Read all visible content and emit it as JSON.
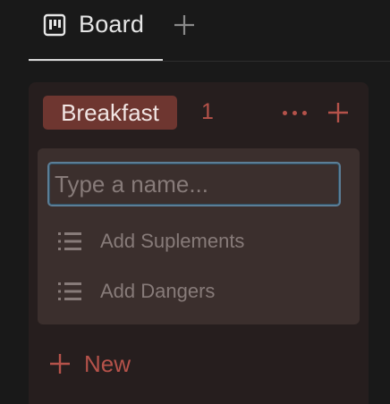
{
  "tabbar": {
    "tabs": [
      {
        "label": "Board",
        "icon": "board-icon",
        "active": true
      }
    ],
    "add_tab_icon": "plus-icon"
  },
  "column": {
    "group_label": "Breakfast",
    "count": "1",
    "more_icon": "more-horizontal-icon",
    "add_icon": "plus-icon",
    "accent_color": "#b5524a",
    "tag_color": "#6e3630"
  },
  "card": {
    "name_input": {
      "value": "",
      "placeholder": "Type a name..."
    },
    "properties": [
      {
        "label": "Add Suplements",
        "icon": "list-icon"
      },
      {
        "label": "Add Dangers",
        "icon": "list-icon"
      }
    ]
  },
  "new_item": {
    "label": "New",
    "icon": "plus-icon"
  }
}
